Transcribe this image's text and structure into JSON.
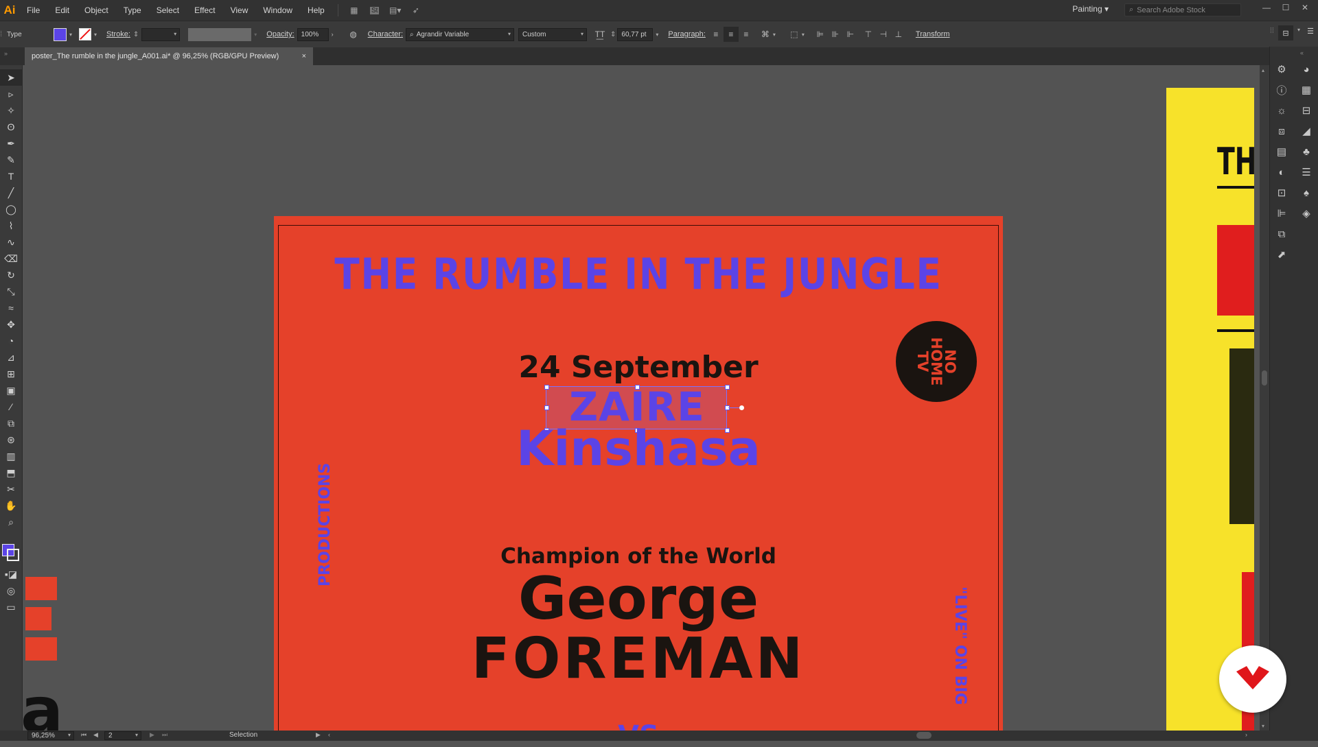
{
  "app": {
    "logo": "Ai",
    "workspace": "Painting",
    "search_placeholder": "Search Adobe Stock"
  },
  "menu": [
    "File",
    "Edit",
    "Object",
    "Type",
    "Select",
    "Effect",
    "View",
    "Window",
    "Help"
  ],
  "control_bar": {
    "tool_label": "Type",
    "stroke_label": "Stroke:",
    "opacity_label": "Opacity:",
    "opacity_value": "100%",
    "character_label": "Character:",
    "font_family": "Agrandir Variable",
    "font_style": "Custom",
    "font_size": "60,77 pt",
    "paragraph_label": "Paragraph:",
    "transform_label": "Transform",
    "fill_color": "#5b44e6"
  },
  "document_tab": {
    "title": "poster_The rumble in the jungle_A001.ai* @ 96,25% (RGB/GPU Preview)",
    "close": "×"
  },
  "poster": {
    "title": "THE RUMBLE IN THE JUNGLE",
    "date": "24 September",
    "country": "ZAIRE",
    "city": "Kinshasa",
    "badge": "NO\nHOME\nTV",
    "subtitle": "Champion of the World",
    "first_name": "George",
    "last_name": "FOREMAN",
    "side_left": "PRODUCTIONS",
    "side_right": "\"LIVE\" ON BIG",
    "vs": "VS"
  },
  "artboard2": {
    "title_fragment": "THE"
  },
  "statusbar": {
    "zoom": "96,25%",
    "artboard_number": "2",
    "tool": "Selection"
  },
  "colors": {
    "poster_bg": "#e5412a",
    "accent": "#5b44e6",
    "ink": "#1a1410",
    "yellow": "#f7e22a"
  }
}
